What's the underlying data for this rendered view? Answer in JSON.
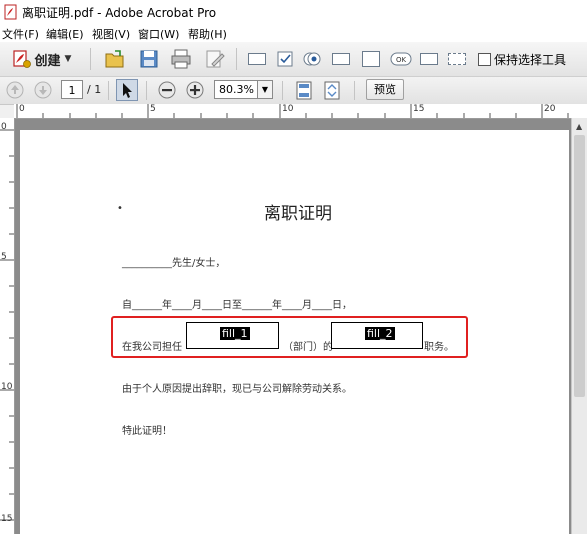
{
  "window": {
    "title": "离职证明.pdf - Adobe Acrobat Pro"
  },
  "menu": [
    "文件(F)",
    "编辑(E)",
    "视图(V)",
    "窗口(W)",
    "帮助(H)"
  ],
  "toolbar": {
    "create_label": "创建",
    "keep_tool_label": "保持选择工具"
  },
  "nav": {
    "page_current": "1",
    "page_total": "/ 1",
    "zoom": "80.3%",
    "preview_label": "预览"
  },
  "ruler": {
    "h_ticks": [
      "0",
      "5",
      "10",
      "15",
      "20"
    ],
    "v_ticks": [
      "0",
      "5",
      "10",
      "15"
    ]
  },
  "document": {
    "title": "离职证明",
    "line1": "__________先生/女士，",
    "line2": "自______年____月____日至______年____月____日，",
    "line3_prefix": "在我公司担任",
    "line3_mid": "（部门）的",
    "line3_suffix": "职务。",
    "line4": "由于个人原因提出辞职，现已与公司解除劳动关系。",
    "line5": "特此证明！"
  },
  "fields": [
    {
      "name": "fill_1"
    },
    {
      "name": "fill_2"
    }
  ]
}
